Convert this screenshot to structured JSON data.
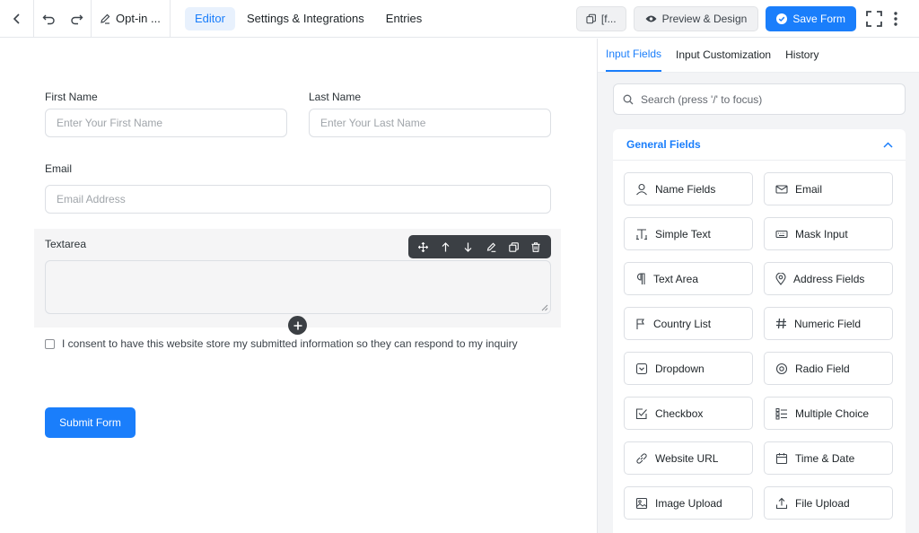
{
  "topbar": {
    "form_title": "Opt-in ...",
    "tabs": [
      {
        "label": "Editor",
        "active": true
      },
      {
        "label": "Settings & Integrations",
        "active": false
      },
      {
        "label": "Entries",
        "active": false
      }
    ],
    "shortcode_label": "[f...",
    "preview_label": "Preview & Design",
    "save_label": "Save Form"
  },
  "form": {
    "first_name": {
      "label": "First Name",
      "placeholder": "Enter Your First Name"
    },
    "last_name": {
      "label": "Last Name",
      "placeholder": "Enter Your Last Name"
    },
    "email": {
      "label": "Email",
      "placeholder": "Email Address"
    },
    "textarea": {
      "label": "Textarea"
    },
    "consent_text": "I consent to have this website store my submitted information so they can respond to my inquiry",
    "submit_label": "Submit Form"
  },
  "panel": {
    "tabs": [
      {
        "label": "Input Fields",
        "active": true
      },
      {
        "label": "Input Customization",
        "active": false
      },
      {
        "label": "History",
        "active": false
      }
    ],
    "search_placeholder": "Search (press '/' to focus)",
    "section_title": "General Fields",
    "fields": [
      {
        "label": "Name Fields",
        "icon": "user-icon"
      },
      {
        "label": "Email",
        "icon": "envelope-icon"
      },
      {
        "label": "Simple Text",
        "icon": "text-cursor-icon"
      },
      {
        "label": "Mask Input",
        "icon": "keyboard-icon"
      },
      {
        "label": "Text Area",
        "icon": "paragraph-icon"
      },
      {
        "label": "Address Fields",
        "icon": "map-pin-icon"
      },
      {
        "label": "Country List",
        "icon": "flag-icon"
      },
      {
        "label": "Numeric Field",
        "icon": "hash-icon"
      },
      {
        "label": "Dropdown",
        "icon": "dropdown-icon"
      },
      {
        "label": "Radio Field",
        "icon": "radio-icon"
      },
      {
        "label": "Checkbox",
        "icon": "checkbox-icon"
      },
      {
        "label": "Multiple Choice",
        "icon": "list-icon"
      },
      {
        "label": "Website URL",
        "icon": "link-icon"
      },
      {
        "label": "Time & Date",
        "icon": "calendar-icon"
      },
      {
        "label": "Image Upload",
        "icon": "image-icon"
      },
      {
        "label": "File Upload",
        "icon": "upload-icon"
      }
    ]
  },
  "colors": {
    "accent": "#1a7efb",
    "toolbar": "#3b3f44",
    "panel_bg": "#f3f4f6"
  }
}
